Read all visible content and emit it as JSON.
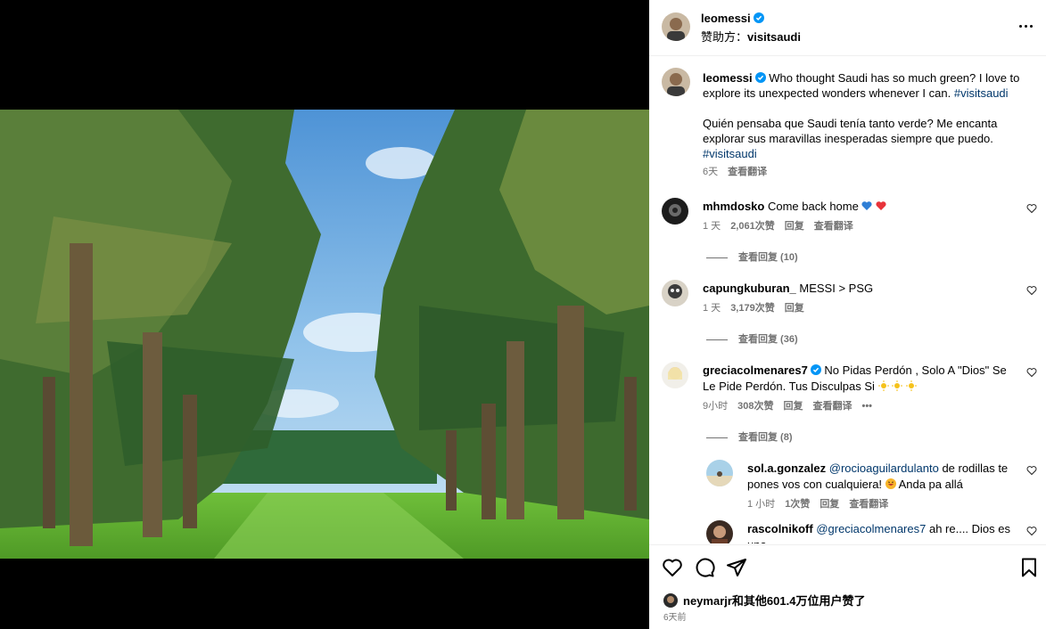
{
  "post": {
    "author": "leomessi",
    "sponsored_label": "赞助方：",
    "sponsor": "visitsaudi"
  },
  "caption": {
    "author": "leomessi",
    "text_en": "Who thought Saudi has so much green? I love to explore its unexpected wonders whenever I can.",
    "hashtag_en": "#visitsaudi",
    "text_es": "Quién pensaba que Saudi tenía tanto verde? Me encanta explorar sus maravillas inesperadas siempre que puedo.",
    "hashtag_es": "#visitsaudi",
    "time": "6天",
    "translate": "查看翻译"
  },
  "comments": [
    {
      "user": "mhmdosko",
      "text": "Come back home",
      "time": "1 天",
      "likes": "2,061次赞",
      "reply": "回复",
      "translate": "查看翻译",
      "replies_label": "查看回复 (10)"
    },
    {
      "user": "capungkuburan_",
      "text": "MESSI > PSG",
      "time": "1 天",
      "likes": "3,179次赞",
      "reply": "回复",
      "replies_label": "查看回复 (36)"
    },
    {
      "user": "greciacolmenares7",
      "text": "No Pidas Perdón , Solo A \"Dios\" Se Le Pide Perdón. Tus Disculpas Si",
      "time": "9小时",
      "likes": "308次赞",
      "reply": "回复",
      "translate": "查看翻译",
      "more": "•••",
      "replies_label": "查看回复 (8)"
    }
  ],
  "subreplies": [
    {
      "user": "sol.a.gonzalez",
      "mention": "@rocioaguilardulanto",
      "text": "de rodillas te pones vos con cualquiera!",
      "text2": "Anda pa allá",
      "time": "1 小时",
      "likes": "1次赞",
      "reply": "回复",
      "translate": "查看翻译"
    },
    {
      "user": "rascolnikoff",
      "mention": "@greciacolmenares7",
      "text": "ah re.... Dios es una"
    }
  ],
  "footer": {
    "liked_by": "neymarjr和其他601.4万位用户赞了",
    "date": "6天前"
  },
  "colors": {
    "link": "#00376b",
    "muted": "#737373",
    "verified": "#0095f6",
    "blue_heart": "#2f7fd6",
    "red_heart": "#e8333a"
  }
}
